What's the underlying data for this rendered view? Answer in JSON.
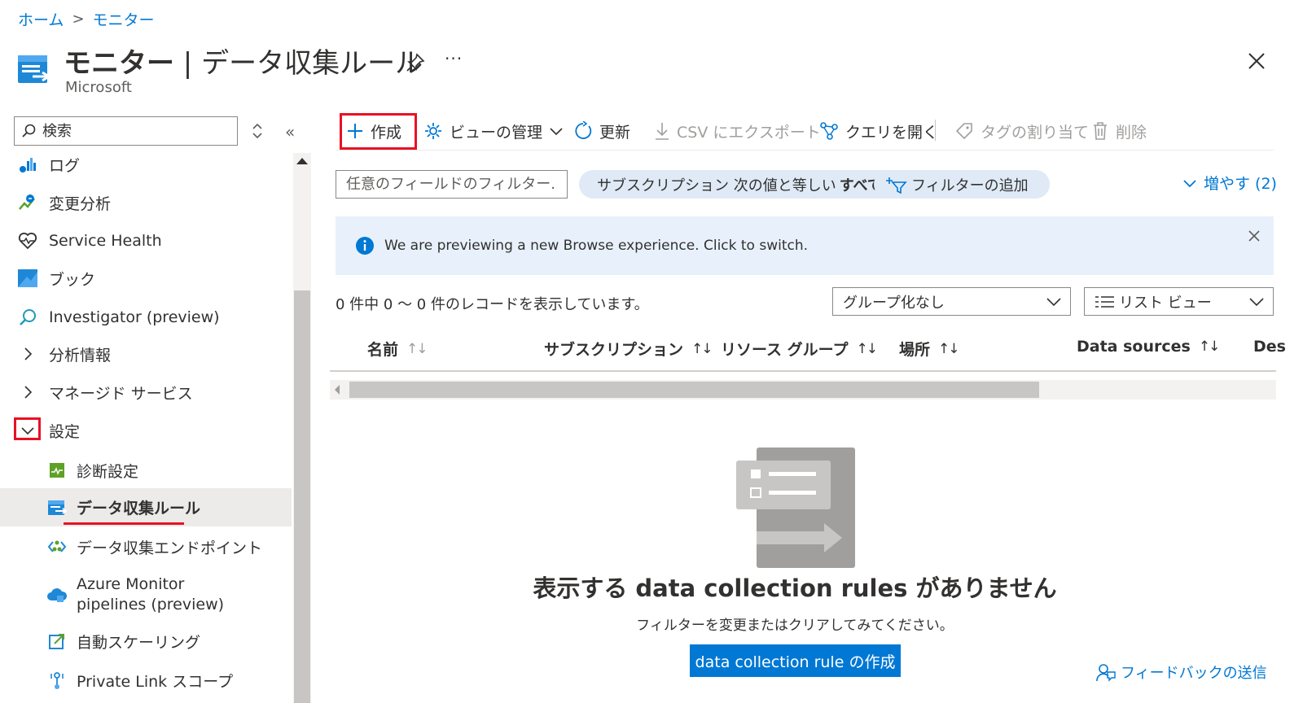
{
  "breadcrumb": {
    "home": "ホーム",
    "separator": ">",
    "current": "モニター"
  },
  "header": {
    "title_bold": "モニター",
    "title_rest": " | データ収集ルール",
    "subtitle": "Microsoft",
    "more": "···"
  },
  "sidebar": {
    "search_placeholder": "検索",
    "collapse": "«",
    "items": [
      {
        "label": "ログ",
        "icon": "log-analytics-icon"
      },
      {
        "label": "変更分析",
        "icon": "change-analysis-icon"
      },
      {
        "label": "Service Health",
        "icon": "heart-pulse-icon"
      },
      {
        "label": "ブック",
        "icon": "workbook-icon"
      },
      {
        "label": "Investigator (preview)",
        "icon": "search-icon"
      },
      {
        "label": "分析情報",
        "icon": "chevron-right-icon"
      },
      {
        "label": "マネージド サービス",
        "icon": "chevron-right-icon"
      },
      {
        "label": "設定",
        "icon": "chevron-down-icon"
      },
      {
        "label": "診断設定",
        "icon": "diagnostic-settings-icon"
      },
      {
        "label": "データ収集ルール",
        "icon": "data-collection-rule-icon"
      },
      {
        "label": "データ収集エンドポイント",
        "icon": "endpoint-icon"
      },
      {
        "label": "Azure Monitor",
        "label2": "pipelines (preview)",
        "icon": "pipeline-cloud-icon"
      },
      {
        "label": "自動スケーリング",
        "icon": "autoscale-icon"
      },
      {
        "label": "Private Link スコープ",
        "icon": "private-link-icon"
      }
    ]
  },
  "toolbar": {
    "create": "作成",
    "manage_view": "ビューの管理",
    "refresh": "更新",
    "export_csv": "CSV にエクスポート",
    "open_query": "クエリを開く",
    "assign_tags": "タグの割り当て",
    "delete": "削除"
  },
  "filters": {
    "placeholder": "任意のフィールドのフィルター...",
    "subscription_prefix": "サブスクリプション 次の値と等しい",
    "subscription_value": "すべて",
    "add_filter": "フィルターの追加",
    "expand": "増やす (2)"
  },
  "banner": {
    "text": "We are previewing a new Browse experience. Click to switch."
  },
  "records": {
    "count_text": "0 件中 0 ～ 0 件のレコードを表示しています。",
    "group_by": "グループ化なし",
    "view_mode": "リスト ビュー"
  },
  "table": {
    "columns": [
      "名前",
      "サブスクリプション",
      "リソース グループ",
      "場所",
      "Data sources",
      "Des"
    ],
    "sort_glyph": "↑↓"
  },
  "empty_state": {
    "title": "表示する data collection rules がありません",
    "subtitle": "フィルターを変更またはクリアしてみてください。",
    "button": "data collection rule の作成"
  },
  "feedback": "フィードバックの送信",
  "colors": {
    "accent": "#0078d4",
    "highlight": "#e81123",
    "banner_bg": "#e8f1fb",
    "pill_bg": "#dfeaf6"
  }
}
